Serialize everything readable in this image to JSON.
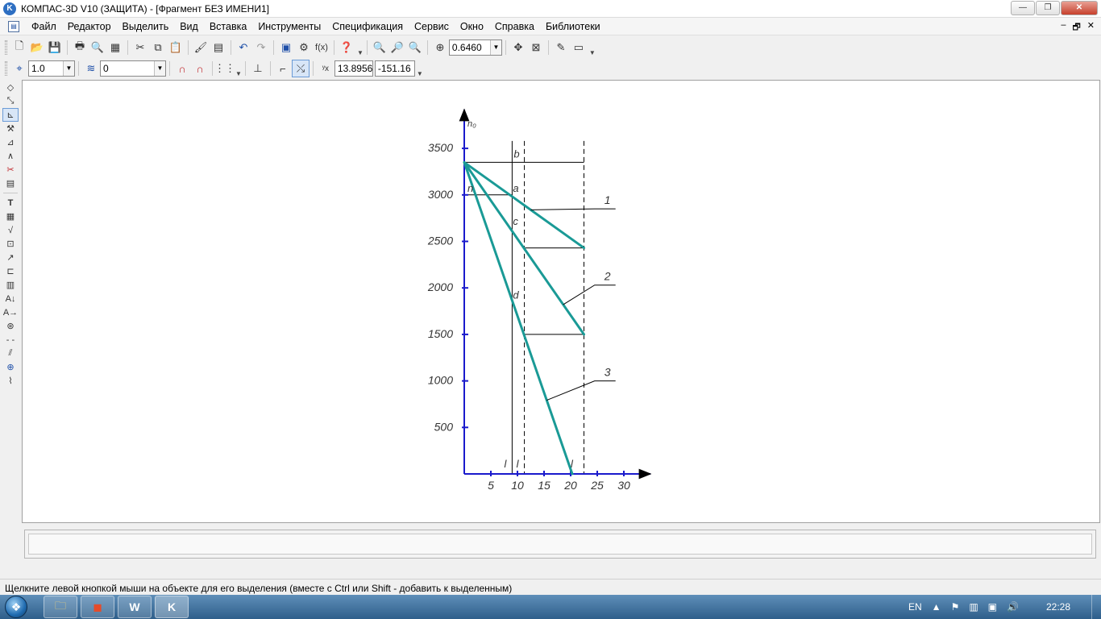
{
  "window": {
    "title": "КОМПАС-3D V10 (ЗАЩИТА) - [Фрагмент БЕЗ ИМЕНИ1]",
    "app_icon_letter": "K",
    "minimize": "—",
    "maximize": "❐",
    "close": "✕"
  },
  "menu": {
    "items": [
      "Файл",
      "Редактор",
      "Выделить",
      "Вид",
      "Вставка",
      "Инструменты",
      "Спецификация",
      "Сервис",
      "Окно",
      "Справка",
      "Библиотеки"
    ],
    "mdi_minimize": "–",
    "mdi_restore": "🗗",
    "mdi_close": "✕"
  },
  "toolbar1": {
    "zoom_value": "0.6460"
  },
  "toolbar2": {
    "step_value": "1.0",
    "layer_value": "0",
    "coord_x": "13.8956",
    "coord_y": "-151.16"
  },
  "drawing": {
    "y_axis_label": "n₀",
    "y_ticks": [
      "3500",
      "3000",
      "2500",
      "2000",
      "1500",
      "1000",
      "500"
    ],
    "x_ticks": [
      "5",
      "10",
      "15",
      "20",
      "25",
      "30"
    ],
    "point_labels": {
      "b": "b",
      "a": "a",
      "c": "c",
      "d": "d",
      "n": "n"
    },
    "x_point_labels": {
      "l1": "l",
      "l2": "l",
      "l3": "l"
    },
    "leader_labels": [
      "1",
      "2",
      "3"
    ]
  },
  "chart_data": {
    "type": "line",
    "title": "",
    "xlabel": "",
    "ylabel": "n₀",
    "xlim": [
      0,
      35
    ],
    "ylim": [
      0,
      3700
    ],
    "x_ticks": [
      5,
      10,
      15,
      20,
      25,
      30
    ],
    "y_ticks": [
      500,
      1000,
      1500,
      2000,
      2500,
      3000,
      3500
    ],
    "series": [
      {
        "name": "1",
        "x": [
          0,
          22.5
        ],
        "y": [
          3350,
          2430
        ]
      },
      {
        "name": "2",
        "x": [
          0,
          22.5
        ],
        "y": [
          3350,
          1500
        ]
      },
      {
        "name": "3",
        "x": [
          0,
          20.3
        ],
        "y": [
          3350,
          0
        ]
      }
    ],
    "vertical_lines": [
      {
        "x": 9,
        "style": "solid"
      },
      {
        "x": 11.3,
        "style": "dashed"
      },
      {
        "x": 22.5,
        "style": "dashed"
      }
    ],
    "horizontal_lines": [
      {
        "y": 3350,
        "x": [
          0,
          22.5
        ]
      },
      {
        "y": 3000,
        "x": [
          0,
          9
        ]
      },
      {
        "y": 2430,
        "x": [
          11.3,
          22.5
        ]
      },
      {
        "y": 1500,
        "x": [
          11.3,
          22.5
        ]
      }
    ],
    "line_color": "#1a9a96"
  },
  "status": {
    "hint": "Щелкните левой кнопкой мыши на объекте для его выделения (вместе с Ctrl или Shift - добавить к выделенным)"
  },
  "taskbar": {
    "lang": "EN",
    "clock": "22:28"
  }
}
